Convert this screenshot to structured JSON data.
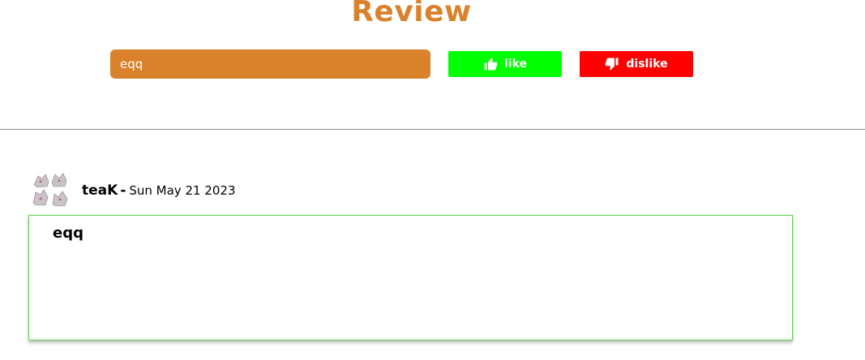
{
  "header": {
    "title": "Review"
  },
  "form": {
    "input_value": "eqq",
    "like_label": "like",
    "like_icon": "thumbs-up-icon",
    "like_color": "#00ff00",
    "dislike_label": "dislike",
    "dislike_icon": "thumbs-down-icon",
    "dislike_color": "#ff0000",
    "input_color": "#d9822b"
  },
  "reviews": [
    {
      "author": "teaK",
      "separator": "-",
      "date": "Sun May 21 2023",
      "text": "eqq",
      "border_color": "#5ecf4a"
    }
  ],
  "colors": {
    "accent": "#d9822b"
  }
}
